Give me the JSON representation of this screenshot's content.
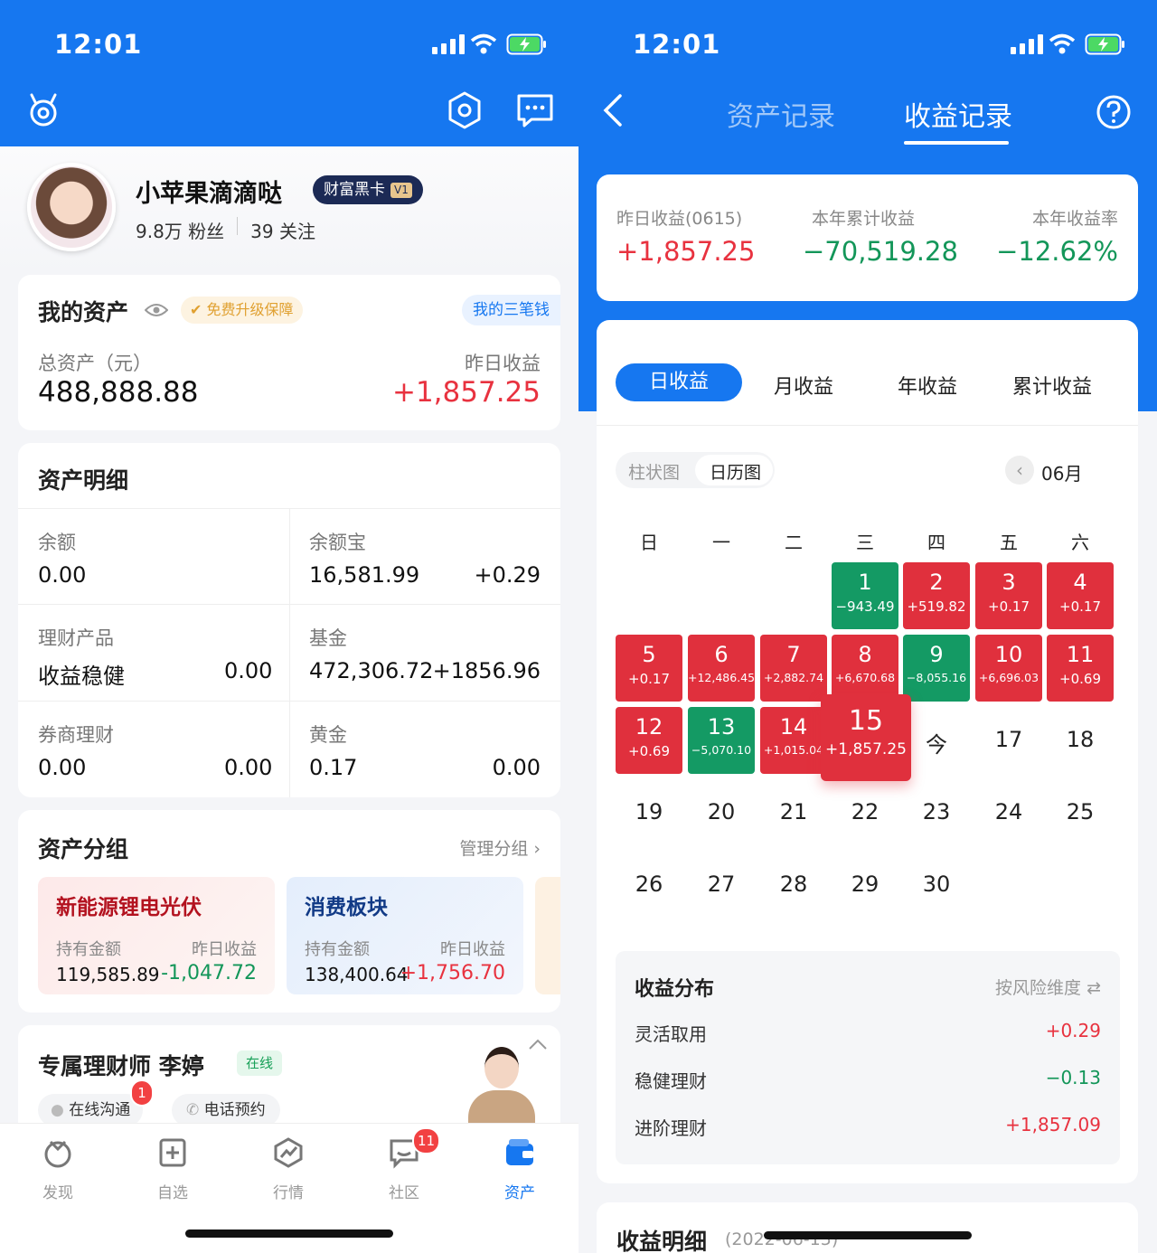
{
  "status_bar": {
    "time": "12:01"
  },
  "left": {
    "profile": {
      "name": "小苹果滴滴哒",
      "vip_label": "财富黑卡",
      "vip_level": "V1",
      "fans": "9.8万 粉丝",
      "follows": "39 关注"
    },
    "my_assets": {
      "title": "我的资产",
      "upgrade_badge": "免费升级保障",
      "three_money": "我的三笔钱",
      "total_label": "总资产（元）",
      "total_value": "488,888.88",
      "yesterday_label": "昨日收益",
      "yesterday_value": "+1,857.25"
    },
    "asset_detail": {
      "title": "资产明细",
      "items": [
        {
          "name": "余额",
          "value": "0.00",
          "extra": ""
        },
        {
          "name": "余额宝",
          "value": "16,581.99",
          "extra": "+0.29"
        },
        {
          "name": "理财产品",
          "sub": "收益稳健",
          "value": "0.00",
          "extra": ""
        },
        {
          "name": "基金",
          "value": "472,306.72",
          "extra": "+1856.96"
        },
        {
          "name": "券商理财",
          "value": "0.00",
          "extra": "0.00"
        },
        {
          "name": "黄金",
          "value": "0.17",
          "extra": "0.00"
        }
      ]
    },
    "asset_group": {
      "title": "资产分组",
      "manage": "管理分组",
      "groups": [
        {
          "name": "新能源锂电光伏",
          "hold_label": "持有金额",
          "yest_label": "昨日收益",
          "hold": "119,585.89",
          "yest": "-1,047.72"
        },
        {
          "name": "消费板块",
          "hold_label": "持有金额",
          "yest_label": "昨日收益",
          "hold": "138,400.64",
          "yest": "+1,756.70"
        }
      ]
    },
    "advisor": {
      "title": "专属理财师 李婷",
      "online": "在线",
      "chat": "在线沟通",
      "chat_badge": "1",
      "phone": "电话预约"
    },
    "tabbar": [
      {
        "label": "发现",
        "icon": "discover-icon"
      },
      {
        "label": "自选",
        "icon": "watchlist-icon"
      },
      {
        "label": "行情",
        "icon": "market-icon"
      },
      {
        "label": "社区",
        "icon": "community-icon",
        "badge": "11"
      },
      {
        "label": "资产",
        "icon": "assets-icon"
      }
    ]
  },
  "right": {
    "tabs": {
      "asset_record": "资产记录",
      "income_record": "收益记录"
    },
    "summary": {
      "y_label": "昨日收益(0615)",
      "y_value": "+1,857.25",
      "year_label": "本年累计收益",
      "year_value": "−70,519.28",
      "rate_label": "本年收益率",
      "rate_value": "−12.62%"
    },
    "period_tabs": [
      "日收益",
      "月收益",
      "年收益",
      "累计收益"
    ],
    "view_toggle": [
      "柱状图",
      "日历图"
    ],
    "month": "06月",
    "weekdays": [
      "日",
      "一",
      "二",
      "三",
      "四",
      "五",
      "六"
    ],
    "calendar": [
      {
        "day": "1",
        "amount": "−943.49",
        "type": "green"
      },
      {
        "day": "2",
        "amount": "+519.82",
        "type": "red"
      },
      {
        "day": "3",
        "amount": "+0.17",
        "type": "red"
      },
      {
        "day": "4",
        "amount": "+0.17",
        "type": "red"
      },
      {
        "day": "5",
        "amount": "+0.17",
        "type": "red"
      },
      {
        "day": "6",
        "amount": "+12,486.45",
        "type": "red"
      },
      {
        "day": "7",
        "amount": "+2,882.74",
        "type": "red"
      },
      {
        "day": "8",
        "amount": "+6,670.68",
        "type": "red"
      },
      {
        "day": "9",
        "amount": "−8,055.16",
        "type": "green"
      },
      {
        "day": "10",
        "amount": "+6,696.03",
        "type": "red"
      },
      {
        "day": "11",
        "amount": "+0.69",
        "type": "red"
      },
      {
        "day": "12",
        "amount": "+0.69",
        "type": "red"
      },
      {
        "day": "13",
        "amount": "−5,070.10",
        "type": "green"
      },
      {
        "day": "14",
        "amount": "+1,015.04",
        "type": "red"
      },
      {
        "day": "15",
        "amount": "+1,857.25",
        "type": "red"
      },
      {
        "day": "今"
      },
      {
        "day": "17"
      },
      {
        "day": "18"
      },
      {
        "day": "19"
      },
      {
        "day": "20"
      },
      {
        "day": "21"
      },
      {
        "day": "22"
      },
      {
        "day": "23"
      },
      {
        "day": "24"
      },
      {
        "day": "25"
      },
      {
        "day": "26"
      },
      {
        "day": "27"
      },
      {
        "day": "28"
      },
      {
        "day": "29"
      },
      {
        "day": "30"
      }
    ],
    "distribution": {
      "title": "收益分布",
      "dimension": "按风险维度",
      "rows": [
        {
          "name": "灵活取用",
          "value": "+0.29",
          "type": "red"
        },
        {
          "name": "稳健理财",
          "value": "−0.13",
          "type": "green"
        },
        {
          "name": "进阶理财",
          "value": "+1,857.09",
          "type": "red"
        }
      ]
    },
    "detail": {
      "title": "收益明细",
      "date": "(2022-06-15)"
    }
  }
}
